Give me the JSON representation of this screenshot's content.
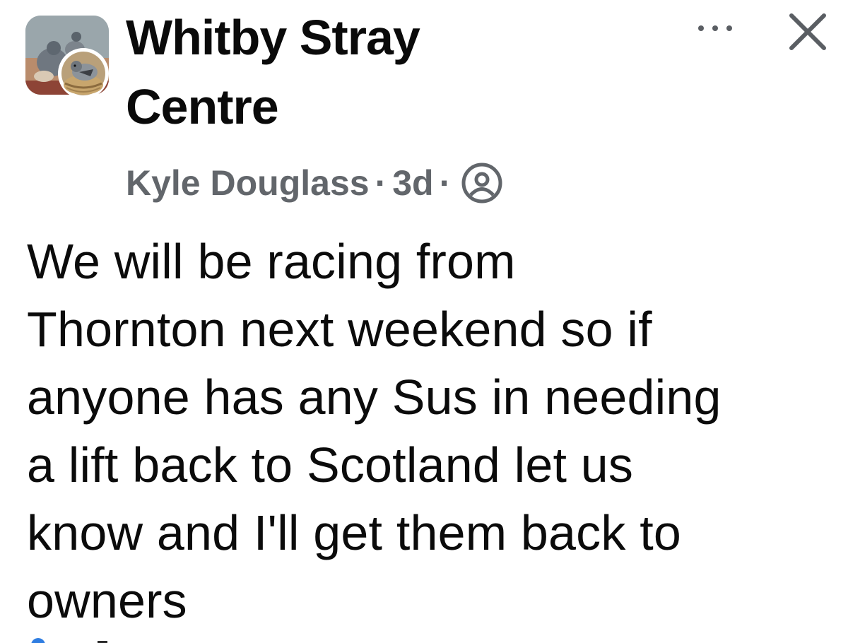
{
  "post": {
    "group_name": "Whitby Stray Centre",
    "author": "Kyle Douglass",
    "separator": "·",
    "time": "3d",
    "privacy_icon": "members-only-icon",
    "body_lines": [
      "We will be racing from",
      "Thornton next weekend so if",
      "anyone has any Sus in needing",
      "a lift back to Scotland let us",
      "know and I'll get them back to",
      "owners"
    ]
  },
  "header": {
    "more_icon": "more-options-icon",
    "close_icon": "close-icon"
  },
  "colors": {
    "text": "#0b0b0b",
    "meta": "#62666b",
    "icon": "#5a5e63",
    "background": "#ffffff"
  }
}
